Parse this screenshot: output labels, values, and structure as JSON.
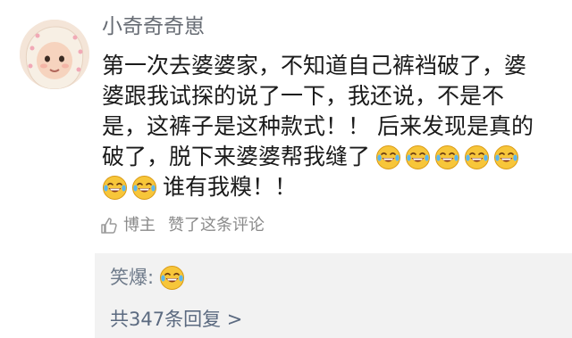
{
  "comment": {
    "username": "小奇奇奇崽",
    "lines": [
      "第一次去婆婆家，不知道自己裤裆破了，婆",
      "婆跟我试探的说了一下，我还说，不是不",
      "是，这裤子是这种款式！！  后来发现是真的",
      "破了，脱下来婆婆帮我缝了",
      "谁有我糗！！"
    ],
    "emoji_icon": "laugh-cry-emoji"
  },
  "like_row": {
    "author_label": "博主",
    "action_text": "赞了这条评论"
  },
  "reply": {
    "author_label": "笑爆:",
    "more_text": "共347条回复 >"
  }
}
